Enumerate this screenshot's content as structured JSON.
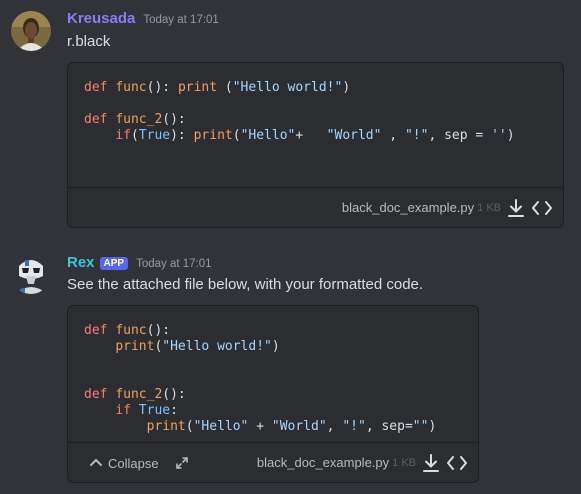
{
  "messages": [
    {
      "username": "Kreusada",
      "username_color": "#8b7cf6",
      "timestamp": "Today at 17:01",
      "text": "r.black",
      "attachment": {
        "file_name": "black_doc_example.py",
        "file_size": "1 KB",
        "code_lines": [
          "def func(): print (\"Hello world!\")",
          "",
          "def func_2():",
          "    if(True): print(\"Hello\"+   \"World\" , \"!\", sep = '')"
        ]
      }
    },
    {
      "username": "Rex",
      "username_color": "#3ac6d9",
      "badge": "APP",
      "timestamp": "Today at 17:01",
      "text": "See the attached file below, with your formatted code.",
      "attachment": {
        "file_name": "black_doc_example.py",
        "file_size": "1 KB",
        "collapse_label": "Collapse",
        "code_lines": [
          "def func():",
          "    print(\"Hello world!\")",
          "",
          "",
          "def func_2():",
          "    if True:",
          "        print(\"Hello\" + \"World\", \"!\", sep=\"\")"
        ]
      }
    }
  ],
  "icons": {
    "download": "download-icon",
    "code_view": "code-view-icon",
    "collapse": "chevron-up-icon",
    "expand": "expand-arrows-icon"
  },
  "colors": {
    "background": "#313338",
    "attachment_bg": "#2b2d31",
    "keyword": "#ff7b72",
    "function": "#f0a15e",
    "string": "#a5d6ff",
    "badge": "#5865f2"
  }
}
